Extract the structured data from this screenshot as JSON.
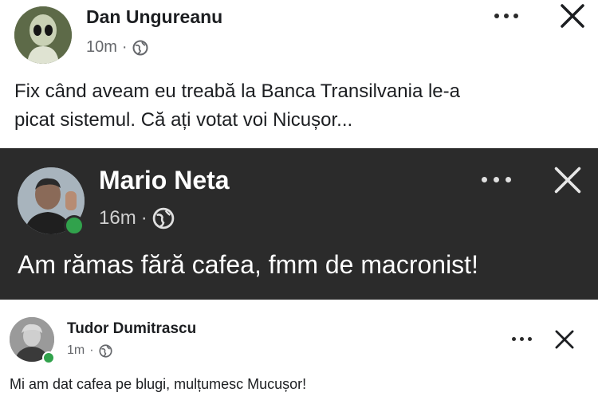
{
  "posts": [
    {
      "author": "Dan Ungureanu",
      "time": "10m",
      "separator": "·",
      "audience_icon": "globe-icon",
      "text": "Fix când aveam eu treabă la Banca Transilvania le-a\npicat sistemul. Că ați votat voi Nicușor..."
    },
    {
      "author": "Mario Neta",
      "time": "16m",
      "separator": "·",
      "audience_icon": "globe-icon",
      "text": "Am rămas fără cafea, fmm de macronist!"
    },
    {
      "author": "Tudor Dumitrascu",
      "time": "1m",
      "separator": "·",
      "audience_icon": "globe-icon",
      "text": "Mi am dat cafea pe blugi, mulțumesc Mucușor!"
    }
  ],
  "colors": {
    "dark_bg": "#2b2b2b",
    "online": "#31a24c",
    "text_dark": "#1c1e21",
    "meta_gray": "#65676b"
  }
}
